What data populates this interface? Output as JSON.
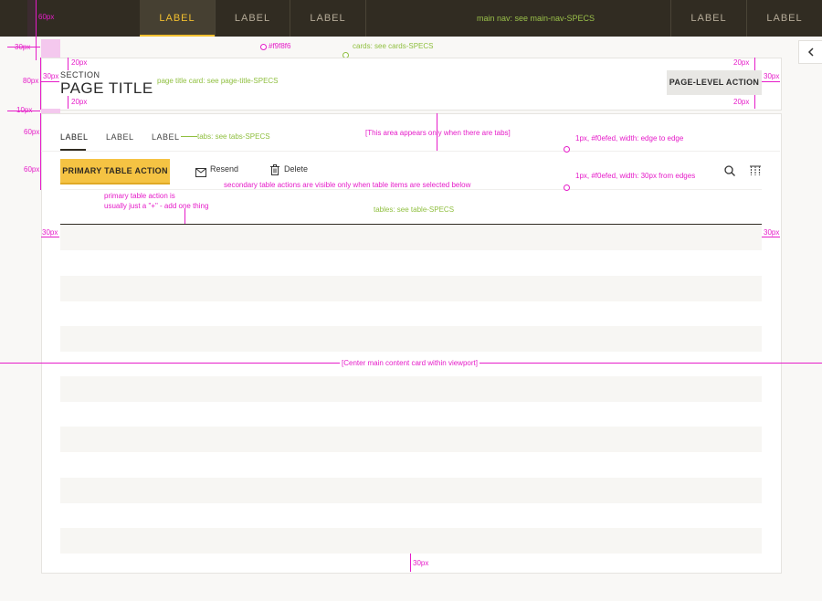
{
  "main_nav": {
    "tabs": [
      "LABEL",
      "LABEL",
      "LABEL"
    ],
    "right_tabs": [
      "LABEL",
      "LABEL"
    ],
    "note": "main nav: see main-nav-SPECS"
  },
  "page_title_card": {
    "section": "SECTION",
    "title": "PAGE TITLE",
    "note": "page title card: see page-title-SPECS",
    "action": "PAGE-LEVEL ACTION"
  },
  "cards_note": "cards: see cards-SPECS",
  "bg_color_note": "#f9f8f6",
  "tabs": {
    "items": [
      "LABEL",
      "LABEL",
      "LABEL"
    ],
    "note": "tabs: see tabs-SPECS",
    "area_note": "[This area appears only when there are tabs]"
  },
  "table": {
    "primary_action": "PRIMARY TABLE ACTION",
    "secondary_actions": [
      "Resend",
      "Delete"
    ],
    "primary_note_1": "primary table action is",
    "primary_note_2": "usually just a \"+\" - add one thing",
    "secondary_note": "secondary table actions are visible only when table items are selected below",
    "note": "tables: see table-SPECS",
    "divider_note_1": "1px, #f0efed, width: edge to edge",
    "divider_note_2": "1px, #f0efed, width: 30px from edges"
  },
  "center_note": "[Center main content card within viewport]",
  "measures": {
    "m60": "60px",
    "m30": "30px",
    "m20": "20px",
    "m80": "80px",
    "m10": "10px"
  },
  "colors": {
    "nav_bg": "#312c22",
    "accent": "#f2bf2f",
    "annotation": "#e61cc9",
    "note_green": "#8fbf3f"
  }
}
